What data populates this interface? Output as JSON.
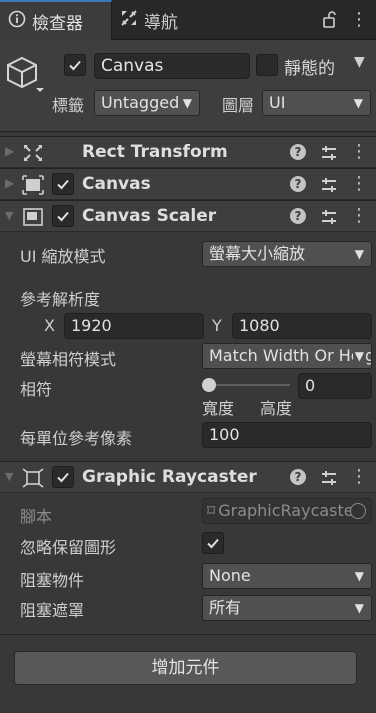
{
  "tabs": [
    {
      "label": "檢查器",
      "icon": "info-icon"
    },
    {
      "label": "導航",
      "icon": "navigation-icon"
    }
  ],
  "gameobject": {
    "name": "Canvas",
    "active": true,
    "static_label": "靜態的",
    "static_checked": false,
    "tag_label": "標籤",
    "tag_value": "Untagged",
    "layer_label": "圖層",
    "layer_value": "UI"
  },
  "components": [
    {
      "title": "Rect Transform",
      "icon": "rect-transform-icon",
      "expanded": false,
      "has_checkbox": false
    },
    {
      "title": "Canvas",
      "icon": "canvas-icon",
      "expanded": false,
      "has_checkbox": true,
      "enabled": true
    },
    {
      "title": "Canvas Scaler",
      "icon": "canvas-scaler-icon",
      "expanded": true,
      "has_checkbox": true,
      "enabled": true
    },
    {
      "title": "Graphic Raycaster",
      "icon": "graphic-raycaster-icon",
      "expanded": true,
      "has_checkbox": true,
      "enabled": true
    }
  ],
  "canvas_scaler": {
    "scale_mode_label": "UI 縮放模式",
    "scale_mode_value": "螢幕大小縮放",
    "ref_res_label": "參考解析度",
    "x_label": "X",
    "x_value": "1920",
    "y_label": "Y",
    "y_value": "1080",
    "match_mode_label": "螢幕相符模式",
    "match_mode_value": "Match Width Or Height",
    "match_label": "相符",
    "match_value": "0",
    "match_fraction": 0,
    "width_label": "寬度",
    "height_label": "高度",
    "ppu_label": "每單位參考像素",
    "ppu_value": "100"
  },
  "graphic_raycaster": {
    "script_label": "腳本",
    "script_value": "GraphicRaycaster",
    "ignore_reversed_label": "忽略保留圖形",
    "ignore_reversed_checked": true,
    "blocking_objects_label": "阻塞物件",
    "blocking_objects_value": "None",
    "blocking_mask_label": "阻塞遮罩",
    "blocking_mask_value": "所有"
  },
  "add_component_label": "增加元件",
  "colors": {
    "accent": "#3a79bb",
    "background": "#383838",
    "header": "#3e3e3e"
  }
}
